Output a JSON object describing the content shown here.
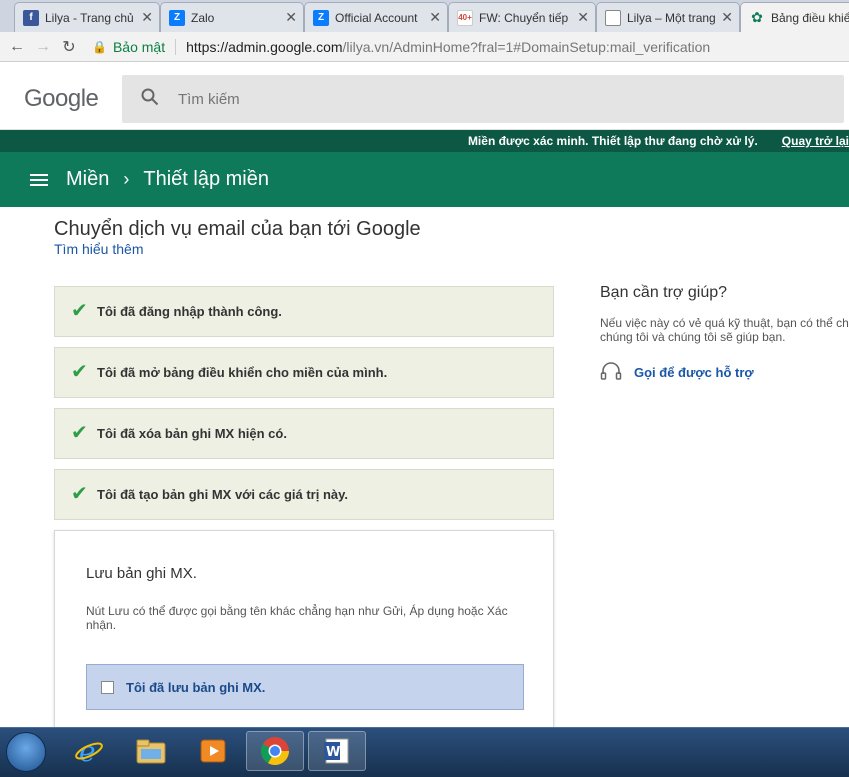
{
  "browser": {
    "tabs": [
      {
        "title": "Lilya - Trang chủ",
        "icon": "facebook-icon",
        "color": "#3b5998",
        "glyph": "f"
      },
      {
        "title": "Zalo",
        "icon": "zalo-icon",
        "color": "#0a7cff",
        "glyph": "Z"
      },
      {
        "title": "Official Account",
        "icon": "zalo-oa-icon",
        "color": "#0a7cff",
        "glyph": "Z"
      },
      {
        "title": "FW: Chuyển tiếp",
        "icon": "gmail-icon",
        "color": "#d44638",
        "glyph": "M"
      },
      {
        "title": "Lilya – Một trang",
        "icon": "document-icon",
        "color": "#888888",
        "glyph": ""
      },
      {
        "title": "Bảng điều khiển",
        "icon": "admin-icon",
        "color": "#0f7a5a",
        "glyph": "✿"
      }
    ],
    "gmail_badge": "40+",
    "security_label": "Bảo mật",
    "url_host": "https://admin.google.com",
    "url_rest": "/lilya.vn/AdminHome?fral=1#DomainSetup:mail_verification"
  },
  "header": {
    "logo": "Google",
    "search_placeholder": "Tìm kiếm"
  },
  "notification": {
    "text": "Miền được xác minh. Thiết lập thư đang chờ xử lý.",
    "link": "Quay trở lại"
  },
  "appbar": {
    "crumb_root": "Miền",
    "crumb_current": "Thiết lập miền"
  },
  "main": {
    "title": "Chuyển dịch vụ email của bạn tới Google",
    "learn_more": "Tìm hiểu thêm",
    "steps": [
      {
        "label": "Tôi đã đăng nhập thành công.",
        "checked": true
      },
      {
        "label": "Tôi đã mở bảng điều khiển cho miền của mình.",
        "checked": true
      },
      {
        "label": "Tôi đã xóa bản ghi MX hiện có.",
        "checked": true
      },
      {
        "label": "Tôi đã tạo bản ghi MX với các giá trị này.",
        "checked": true
      }
    ],
    "save_card": {
      "title": "Lưu bản ghi MX.",
      "description": "Nút Lưu có thể được gọi bằng tên khác chẳng hạn như Gửi, Áp dụng hoặc Xác nhận.",
      "checkbox_label": "Tôi đã lưu bản ghi MX.",
      "checked": false
    }
  },
  "help": {
    "title": "Bạn cần trợ giúp?",
    "text": "Nếu việc này có vẻ quá kỹ thuật, bạn có thể cho chúng tôi và chúng tôi sẽ giúp bạn.",
    "link": "Gọi để được hỗ trợ"
  },
  "taskbar": {
    "items": [
      "start-button",
      "internet-explorer-icon",
      "file-explorer-icon",
      "media-player-icon",
      "chrome-icon",
      "word-icon"
    ]
  },
  "colors": {
    "appbar": "#0f7a5a",
    "notification": "#0d5844",
    "check": "#2e9d45",
    "link": "#1a57a6"
  }
}
